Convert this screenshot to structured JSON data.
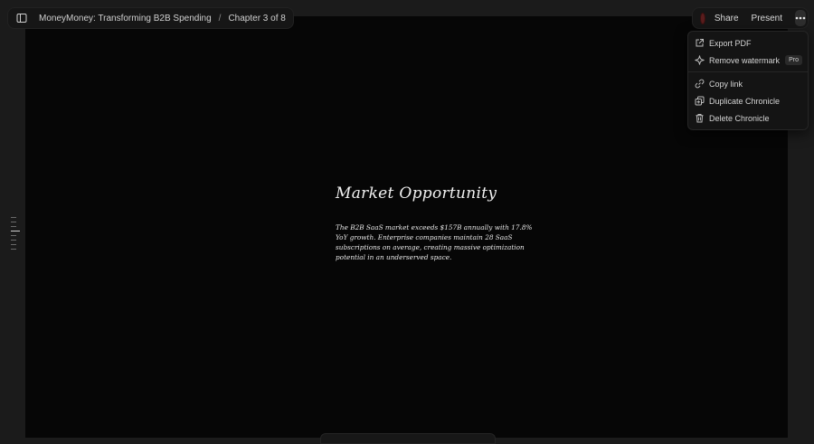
{
  "header": {
    "deck_title": "MoneyMoney: Transforming B2B Spending",
    "separator": "/",
    "chapter": "Chapter 3 of 8"
  },
  "actions": {
    "share": "Share",
    "present": "Present"
  },
  "menu": {
    "items": [
      {
        "label": "Export PDF",
        "icon": "export-icon"
      },
      {
        "label": "Remove watermark",
        "icon": "sparkle-icon",
        "badge": "Pro"
      },
      {
        "label": "Copy link",
        "icon": "link-icon"
      },
      {
        "label": "Duplicate Chronicle",
        "icon": "duplicate-icon"
      },
      {
        "label": "Delete Chronicle",
        "icon": "trash-icon"
      }
    ]
  },
  "slide": {
    "title": "Market Opportunity",
    "body": "The B2B SaaS market exceeds $157B annually with 17.8% YoY growth. Enterprise companies maintain 28 SaaS subscriptions on average, creating massive optimization potential in an underserved space."
  },
  "colors": {
    "background": "#1b1b1b",
    "canvas": "#060606",
    "avatar": "#5a1d1d"
  }
}
